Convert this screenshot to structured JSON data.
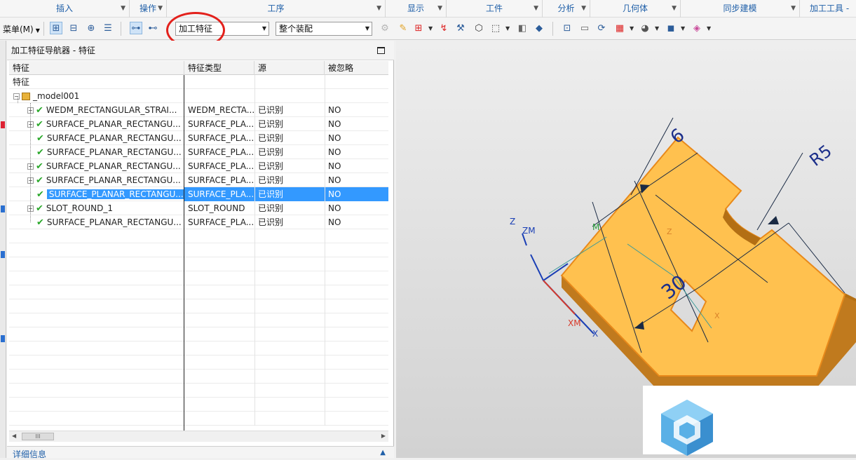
{
  "ribbon_groups": [
    {
      "label": "插入"
    },
    {
      "label": "操作"
    },
    {
      "label": "工序"
    },
    {
      "label": "显示"
    },
    {
      "label": "工件"
    },
    {
      "label": "分析"
    },
    {
      "label": "几何体"
    },
    {
      "label": "同步建模"
    },
    {
      "label": "加工工具 - G"
    }
  ],
  "toolbar": {
    "menu_label": "菜单(M)",
    "filter_combo_value": "加工特征",
    "scope_combo_value": "整个装配"
  },
  "navigator": {
    "title": "加工特征导航器 - 特征",
    "columns": [
      "特征",
      "特征类型",
      "源",
      "被忽略"
    ],
    "root_label": "特征",
    "model_label": "_model001",
    "rows": [
      {
        "name": "WEDM_RECTANGULAR_STRAI...",
        "type": "WEDM_RECTA...",
        "source": "已识别",
        "ignored": "NO"
      },
      {
        "name": "SURFACE_PLANAR_RECTANGU...",
        "type": "SURFACE_PLA...",
        "source": "已识别",
        "ignored": "NO"
      },
      {
        "name": "SURFACE_PLANAR_RECTANGU...",
        "type": "SURFACE_PLA...",
        "source": "已识别",
        "ignored": "NO"
      },
      {
        "name": "SURFACE_PLANAR_RECTANGU...",
        "type": "SURFACE_PLA...",
        "source": "已识别",
        "ignored": "NO"
      },
      {
        "name": "SURFACE_PLANAR_RECTANGU...",
        "type": "SURFACE_PLA...",
        "source": "已识别",
        "ignored": "NO"
      },
      {
        "name": "SURFACE_PLANAR_RECTANGU...",
        "type": "SURFACE_PLA...",
        "source": "已识别",
        "ignored": "NO"
      },
      {
        "name": "SURFACE_PLANAR_RECTANGU...",
        "type": "SURFACE_PLA...",
        "source": "已识别",
        "ignored": "NO"
      },
      {
        "name": "SLOT_ROUND_1",
        "type": "SLOT_ROUND",
        "source": "已识别",
        "ignored": "NO"
      },
      {
        "name": "SURFACE_PLANAR_RECTANGU...",
        "type": "SURFACE_PLA...",
        "source": "已识别",
        "ignored": "NO"
      }
    ],
    "selected_row": 6,
    "scroll_thumb": "III",
    "details_label": "详细信息"
  },
  "viewport": {
    "dimension_6": "6",
    "dimension_r5": "R5",
    "dimension_30": "30",
    "axis_z": "Z",
    "axis_zm": "ZM",
    "axis_xm": "XM",
    "axis_x": "X",
    "axis_m": "M",
    "axis_z2": "Z",
    "axis_x2": "X",
    "part_color": "#ffc04d"
  },
  "colors": {
    "accent_blue": "#1f5fa8",
    "selection": "#3399ff",
    "highlight_ring": "#e3211c",
    "check_green": "#2aa82a"
  }
}
